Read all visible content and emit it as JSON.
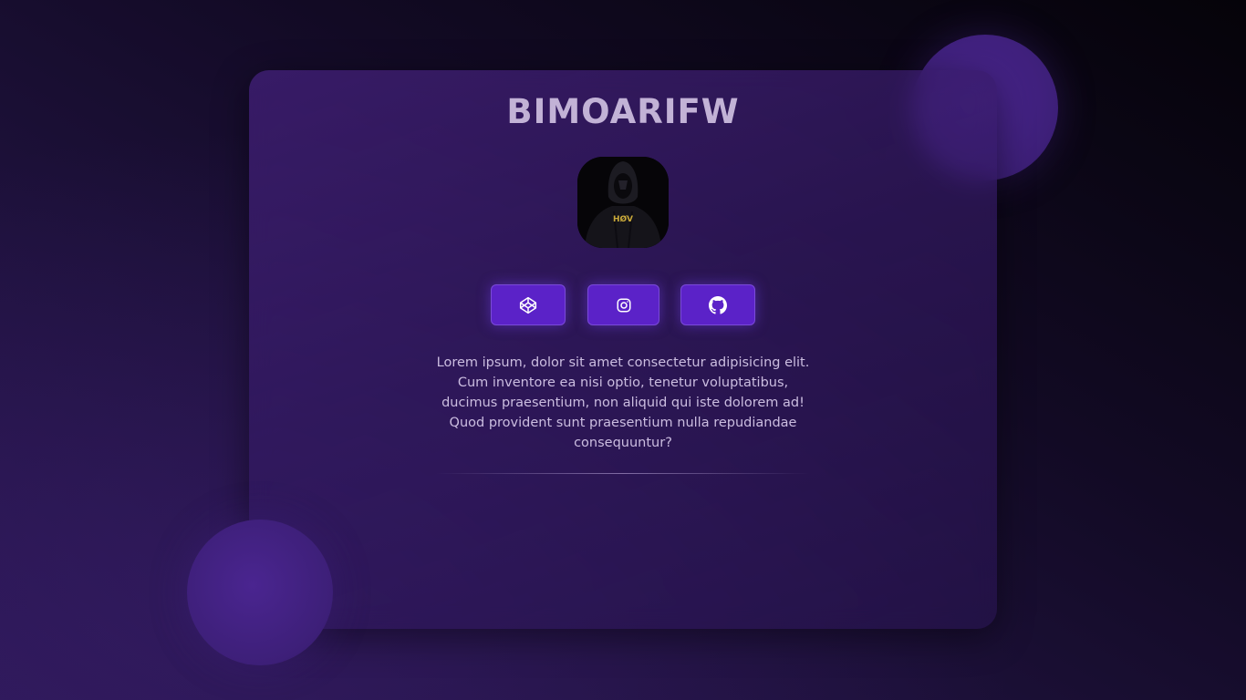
{
  "profile": {
    "name": "BIMOARIFW",
    "avatar_text": "HØV",
    "description": "Lorem ipsum, dolor sit amet consectetur adipisicing elit. Cum inventore ea nisi optio, tenetur voluptatibus, ducimus praesentium, non aliquid qui iste dolorem ad! Quod provident sunt praesentium nulla repudiandae consequuntur?"
  },
  "social_links": [
    {
      "icon": "codepen-icon"
    },
    {
      "icon": "instagram-icon"
    },
    {
      "icon": "github-icon"
    }
  ],
  "colors": {
    "accent": "#5b22c8",
    "title": "#c2b2d6",
    "card": "#42207a"
  }
}
